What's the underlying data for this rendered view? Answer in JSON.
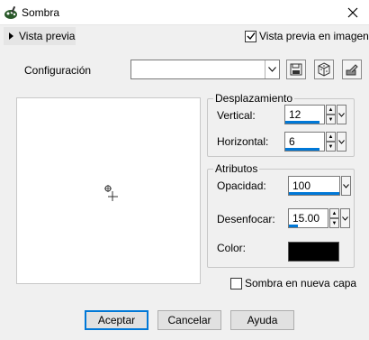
{
  "window": {
    "title": "Sombra",
    "icon": "paint-app-icon"
  },
  "preview_toggle": {
    "label": "Vista previa"
  },
  "preview_checkbox": {
    "label": "Vista previa en imagen",
    "checked": true
  },
  "config": {
    "label": "Configuración",
    "value": ""
  },
  "toolbar": {
    "icons": [
      "save-icon",
      "cube-icon",
      "reset-icon"
    ]
  },
  "offset": {
    "title": "Desplazamiento",
    "vertical": {
      "label": "Vertical:",
      "value": "12"
    },
    "horizontal": {
      "label": "Horizontal:",
      "value": "6"
    }
  },
  "attributes": {
    "title": "Atributos",
    "opacity": {
      "label": "Opacidad:",
      "value": "100"
    },
    "blur": {
      "label": "Desenfocar:",
      "value": "15.00"
    },
    "color": {
      "label": "Color:",
      "value": "#000000"
    }
  },
  "new_layer": {
    "label": "Sombra en nueva capa",
    "checked": false
  },
  "buttons": {
    "ok": "Aceptar",
    "cancel": "Cancelar",
    "help": "Ayuda"
  },
  "colors": {
    "accent": "#0078d7",
    "shadow": "#000000"
  }
}
